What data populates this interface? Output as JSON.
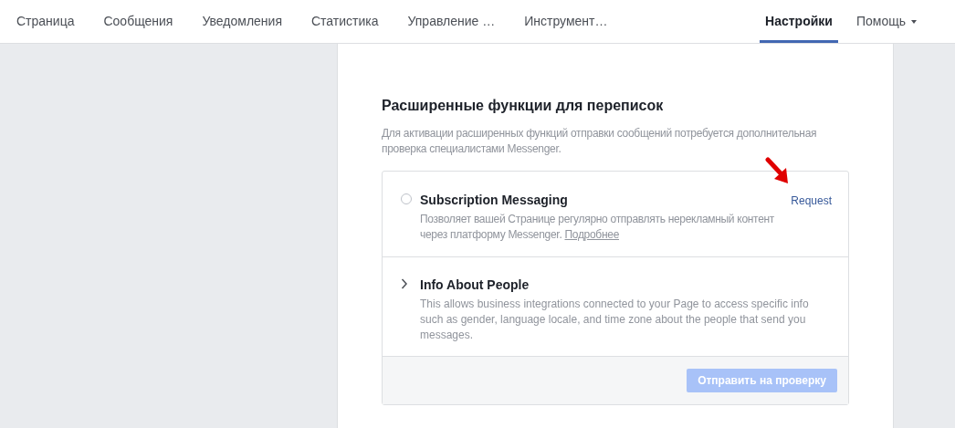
{
  "nav": {
    "tabs": [
      {
        "label": "Страница",
        "selected": false
      },
      {
        "label": "Сообщения",
        "selected": false
      },
      {
        "label": "Уведомления",
        "selected": false
      },
      {
        "label": "Статистика",
        "selected": false
      },
      {
        "label": "Управление …",
        "selected": false
      },
      {
        "label": "Инструмент…",
        "selected": false
      }
    ],
    "right_tabs": [
      {
        "label": "Настройки",
        "selected": true,
        "dropdown": false
      },
      {
        "label": "Помощь",
        "selected": false,
        "dropdown": true
      }
    ]
  },
  "section": {
    "title": "Расширенные функции для переписок",
    "description": "Для активации расширенных функций отправки сообщений потребуется дополнительная проверка специалистами Messenger.",
    "features": [
      {
        "kind": "radio",
        "selected": false,
        "title": "Subscription Messaging",
        "action": "Request",
        "description": "Позволяет вашей Странице регулярно отправлять нерекламный контент через платформу Messenger.",
        "link": "Подробнее"
      },
      {
        "kind": "expand",
        "expanded": false,
        "title": "Info About People",
        "description": "This allows business integrations connected to your Page to access specific info such as gender, language locale, and time zone about the people that send you messages."
      }
    ],
    "submit": {
      "label": "Отправить на проверку",
      "disabled": true
    }
  }
}
